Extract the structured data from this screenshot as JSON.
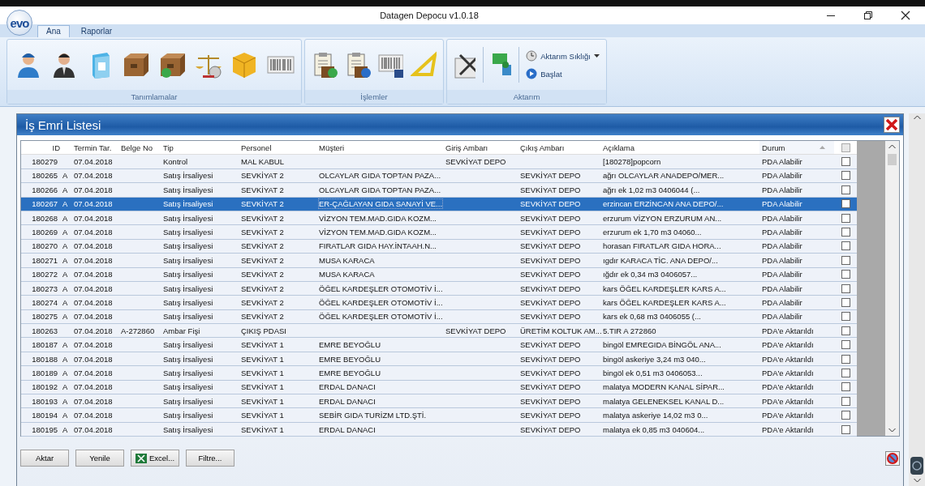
{
  "window": {
    "title": "Datagen Depocu v1.0.18",
    "logo": "evo"
  },
  "tabs": [
    {
      "label": "Ana",
      "selected": true
    },
    {
      "label": "Raporlar",
      "selected": false
    }
  ],
  "ribbon": {
    "groups": [
      {
        "label": "Tanımlamalar"
      },
      {
        "label": "İşlemler"
      },
      {
        "label": "Aktarım"
      }
    ],
    "small_buttons": [
      {
        "label": "Aktarım Sıklığı",
        "dropdown": true
      },
      {
        "label": "Başlat",
        "dropdown": false
      }
    ]
  },
  "panel": {
    "title": "İş Emri Listesi"
  },
  "table": {
    "columns": [
      {
        "label": "ID",
        "sorted": false
      },
      {
        "label": "Termin Tar.",
        "sorted": false
      },
      {
        "label": "Belge No",
        "sorted": false
      },
      {
        "label": "Tip",
        "sorted": false
      },
      {
        "label": "Personel",
        "sorted": false
      },
      {
        "label": "Müşteri",
        "sorted": false
      },
      {
        "label": "Giriş Ambarı",
        "sorted": false
      },
      {
        "label": "Çıkış Ambarı",
        "sorted": false
      },
      {
        "label": "Açıklama",
        "sorted": false
      },
      {
        "label": "Durum",
        "sorted": true
      }
    ],
    "header_checked": false,
    "rows": [
      {
        "id": "180279",
        "flag": "",
        "date": "07.04.2018",
        "belge": "",
        "tip": "Kontrol",
        "personel": "MAL KABUL",
        "musteri": "",
        "giris": "SEVKİYAT DEPO",
        "cikis": "",
        "aciklama": "[180278]popcorn",
        "durum": "PDA Alabilir",
        "checked": false,
        "selected": false
      },
      {
        "id": "180265",
        "flag": "A",
        "date": "07.04.2018",
        "belge": "",
        "tip": "Satış İrsaliyesi",
        "personel": "SEVKİYAT 2",
        "musteri": "OLCAYLAR GIDA TOPTAN PAZA...",
        "giris": "",
        "cikis": "SEVKİYAT DEPO",
        "aciklama": "ağrı OLCAYLAR ANADEPO/MER...",
        "durum": "PDA Alabilir",
        "checked": false,
        "selected": false
      },
      {
        "id": "180266",
        "flag": "A",
        "date": "07.04.2018",
        "belge": "",
        "tip": "Satış İrsaliyesi",
        "personel": "SEVKİYAT 2",
        "musteri": "OLCAYLAR GIDA TOPTAN PAZA...",
        "giris": "",
        "cikis": "SEVKİYAT DEPO",
        "aciklama": "ağrı ek 1,02 m3 0406044 (...",
        "durum": "PDA Alabilir",
        "checked": false,
        "selected": false
      },
      {
        "id": "180267",
        "flag": "A",
        "date": "07.04.2018",
        "belge": "",
        "tip": "Satış İrsaliyesi",
        "personel": "SEVKİYAT 2",
        "musteri": "ER-ÇAĞLAYAN GIDA SANAYİ VE...",
        "giris": "",
        "cikis": "SEVKİYAT DEPO",
        "aciklama": "erzincan ERZİNCAN ANA DEPO/...",
        "durum": "PDA Alabilir",
        "checked": false,
        "selected": true
      },
      {
        "id": "180268",
        "flag": "A",
        "date": "07.04.2018",
        "belge": "",
        "tip": "Satış İrsaliyesi",
        "personel": "SEVKİYAT 2",
        "musteri": "VİZYON TEM.MAD.GIDA KOZM...",
        "giris": "",
        "cikis": "SEVKİYAT DEPO",
        "aciklama": "erzurum VİZYON ERZURUM AN...",
        "durum": "PDA Alabilir",
        "checked": false,
        "selected": false
      },
      {
        "id": "180269",
        "flag": "A",
        "date": "07.04.2018",
        "belge": "",
        "tip": "Satış İrsaliyesi",
        "personel": "SEVKİYAT 2",
        "musteri": "VİZYON TEM.MAD.GIDA KOZM...",
        "giris": "",
        "cikis": "SEVKİYAT DEPO",
        "aciklama": "erzurum ek 1,70 m3 04060...",
        "durum": "PDA Alabilir",
        "checked": false,
        "selected": false
      },
      {
        "id": "180270",
        "flag": "A",
        "date": "07.04.2018",
        "belge": "",
        "tip": "Satış İrsaliyesi",
        "personel": "SEVKİYAT 2",
        "musteri": "FIRATLAR GIDA HAY.İNTAAH.N...",
        "giris": "",
        "cikis": "SEVKİYAT DEPO",
        "aciklama": "horasan FIRATLAR GIDA HORA...",
        "durum": "PDA Alabilir",
        "checked": false,
        "selected": false
      },
      {
        "id": "180271",
        "flag": "A",
        "date": "07.04.2018",
        "belge": "",
        "tip": "Satış İrsaliyesi",
        "personel": "SEVKİYAT 2",
        "musteri": "MUSA KARACA",
        "giris": "",
        "cikis": "SEVKİYAT DEPO",
        "aciklama": "ıgdır KARACA TİC. ANA DEPO/...",
        "durum": "PDA Alabilir",
        "checked": false,
        "selected": false
      },
      {
        "id": "180272",
        "flag": "A",
        "date": "07.04.2018",
        "belge": "",
        "tip": "Satış İrsaliyesi",
        "personel": "SEVKİYAT 2",
        "musteri": "MUSA KARACA",
        "giris": "",
        "cikis": "SEVKİYAT DEPO",
        "aciklama": "ığdır ek 0,34 m3 0406057...",
        "durum": "PDA Alabilir",
        "checked": false,
        "selected": false
      },
      {
        "id": "180273",
        "flag": "A",
        "date": "07.04.2018",
        "belge": "",
        "tip": "Satış İrsaliyesi",
        "personel": "SEVKİYAT 2",
        "musteri": "ÖĞEL KARDEŞLER OTOMOTİV İ...",
        "giris": "",
        "cikis": "SEVKİYAT DEPO",
        "aciklama": "kars ÖĞEL KARDEŞLER KARS A...",
        "durum": "PDA Alabilir",
        "checked": false,
        "selected": false
      },
      {
        "id": "180274",
        "flag": "A",
        "date": "07.04.2018",
        "belge": "",
        "tip": "Satış İrsaliyesi",
        "personel": "SEVKİYAT 2",
        "musteri": "ÖĞEL KARDEŞLER OTOMOTİV İ...",
        "giris": "",
        "cikis": "SEVKİYAT DEPO",
        "aciklama": "kars ÖĞEL KARDEŞLER KARS A...",
        "durum": "PDA Alabilir",
        "checked": false,
        "selected": false
      },
      {
        "id": "180275",
        "flag": "A",
        "date": "07.04.2018",
        "belge": "",
        "tip": "Satış İrsaliyesi",
        "personel": "SEVKİYAT 2",
        "musteri": "ÖĞEL KARDEŞLER OTOMOTİV İ...",
        "giris": "",
        "cikis": "SEVKİYAT DEPO",
        "aciklama": "kars ek 0,68 m3 0406055 (...",
        "durum": "PDA Alabilir",
        "checked": false,
        "selected": false
      },
      {
        "id": "180263",
        "flag": "",
        "date": "07.04.2018",
        "belge": "A-272860",
        "tip": "Ambar Fişi",
        "personel": "ÇIKIŞ PDASI",
        "musteri": "",
        "giris": "SEVKİYAT DEPO",
        "cikis": "ÜRETİM KOLTUK AM...",
        "aciklama": "5.TIR A 272860",
        "durum": "PDA'e Aktarıldı",
        "checked": false,
        "selected": false
      },
      {
        "id": "180187",
        "flag": "A",
        "date": "07.04.2018",
        "belge": "",
        "tip": "Satış İrsaliyesi",
        "personel": "SEVKİYAT 1",
        "musteri": "EMRE BEYOĞLU",
        "giris": "",
        "cikis": "SEVKİYAT DEPO",
        "aciklama": "bingöl EMREGIDA BİNGÖL ANA...",
        "durum": "PDA'e Aktarıldı",
        "checked": false,
        "selected": false
      },
      {
        "id": "180188",
        "flag": "A",
        "date": "07.04.2018",
        "belge": "",
        "tip": "Satış İrsaliyesi",
        "personel": "SEVKİYAT 1",
        "musteri": "EMRE BEYOĞLU",
        "giris": "",
        "cikis": "SEVKİYAT DEPO",
        "aciklama": "bingöl askeriye 3,24 m3 040...",
        "durum": "PDA'e Aktarıldı",
        "checked": false,
        "selected": false
      },
      {
        "id": "180189",
        "flag": "A",
        "date": "07.04.2018",
        "belge": "",
        "tip": "Satış İrsaliyesi",
        "personel": "SEVKİYAT 1",
        "musteri": "EMRE BEYOĞLU",
        "giris": "",
        "cikis": "SEVKİYAT DEPO",
        "aciklama": "bingöl ek 0,51 m3 0406053...",
        "durum": "PDA'e Aktarıldı",
        "checked": false,
        "selected": false
      },
      {
        "id": "180192",
        "flag": "A",
        "date": "07.04.2018",
        "belge": "",
        "tip": "Satış İrsaliyesi",
        "personel": "SEVKİYAT 1",
        "musteri": "ERDAL DANACI",
        "giris": "",
        "cikis": "SEVKİYAT DEPO",
        "aciklama": "malatya MODERN KANAL SİPAR...",
        "durum": "PDA'e Aktarıldı",
        "checked": false,
        "selected": false
      },
      {
        "id": "180193",
        "flag": "A",
        "date": "07.04.2018",
        "belge": "",
        "tip": "Satış İrsaliyesi",
        "personel": "SEVKİYAT 1",
        "musteri": "ERDAL DANACI",
        "giris": "",
        "cikis": "SEVKİYAT DEPO",
        "aciklama": "malatya GELENEKSEL KANAL D...",
        "durum": "PDA'e Aktarıldı",
        "checked": false,
        "selected": false
      },
      {
        "id": "180194",
        "flag": "A",
        "date": "07.04.2018",
        "belge": "",
        "tip": "Satış İrsaliyesi",
        "personel": "SEVKİYAT 1",
        "musteri": "SEBİR GIDA TURİZM LTD.ŞTİ.",
        "giris": "",
        "cikis": "SEVKİYAT DEPO",
        "aciklama": "malatya askeriye 14,02 m3 0...",
        "durum": "PDA'e Aktarıldı",
        "checked": false,
        "selected": false
      },
      {
        "id": "180195",
        "flag": "A",
        "date": "07.04.2018",
        "belge": "",
        "tip": "Satış İrsaliyesi",
        "personel": "SEVKİYAT 1",
        "musteri": "ERDAL DANACI",
        "giris": "",
        "cikis": "SEVKİYAT DEPO",
        "aciklama": "malatya ek 0,85 m3 040604...",
        "durum": "PDA'e Aktarıldı",
        "checked": false,
        "selected": false
      }
    ]
  },
  "buttons": [
    {
      "label": "Aktar",
      "kind": "plain"
    },
    {
      "label": "Yenile",
      "kind": "plain"
    },
    {
      "label": "Excel...",
      "kind": "excel"
    },
    {
      "label": "Filtre...",
      "kind": "plain"
    }
  ]
}
